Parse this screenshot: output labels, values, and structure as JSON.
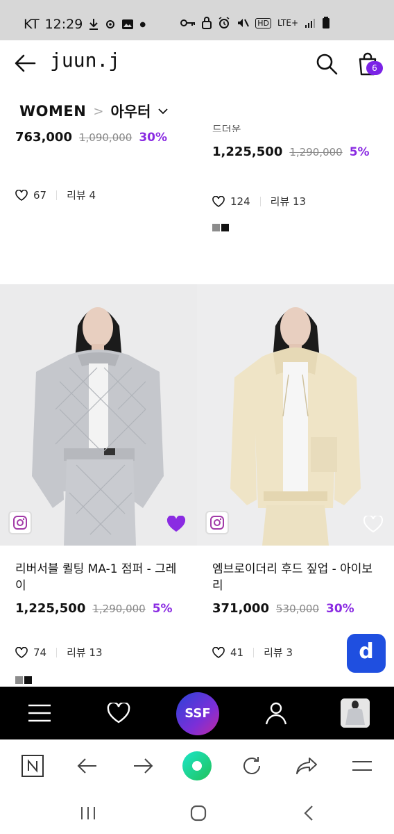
{
  "status_bar": {
    "carrier": "KT",
    "time": "12:29",
    "network": "LTE+"
  },
  "header": {
    "brand": "juun.j",
    "cart_count": "6"
  },
  "breadcrumb": {
    "main": "WOMEN",
    "separator": ">",
    "category": "아우터"
  },
  "products_top": [
    {
      "name_fragment": "",
      "price": "763,000",
      "original_price": "1,090,000",
      "discount": "30%",
      "likes": "67",
      "reviews": "리뷰 4"
    },
    {
      "name_fragment": "드더운",
      "price": "1,225,500",
      "original_price": "1,290,000",
      "discount": "5%",
      "likes": "124",
      "reviews": "리뷰 13"
    }
  ],
  "products": [
    {
      "name": "리버서블 퀼팅 MA-1 점퍼 - 그레이",
      "price": "1,225,500",
      "original_price": "1,290,000",
      "discount": "5%",
      "likes": "74",
      "reviews": "리뷰 13",
      "wishlisted": true
    },
    {
      "name": "엠브로이더리 후드 짚업 - 아이보리",
      "price": "371,000",
      "original_price": "530,000",
      "discount": "30%",
      "likes": "41",
      "reviews": "리뷰 3",
      "wishlisted": false
    }
  ],
  "ssf_bar": {
    "logo": "SSF"
  },
  "floating_button": {
    "label": "d"
  },
  "colors": {
    "accent_purple": "#8a2be2",
    "badge_purple": "#7b23e6",
    "float_blue": "#1f4fe0",
    "swatch_gray": "#8c8c8c",
    "swatch_black": "#111111"
  }
}
